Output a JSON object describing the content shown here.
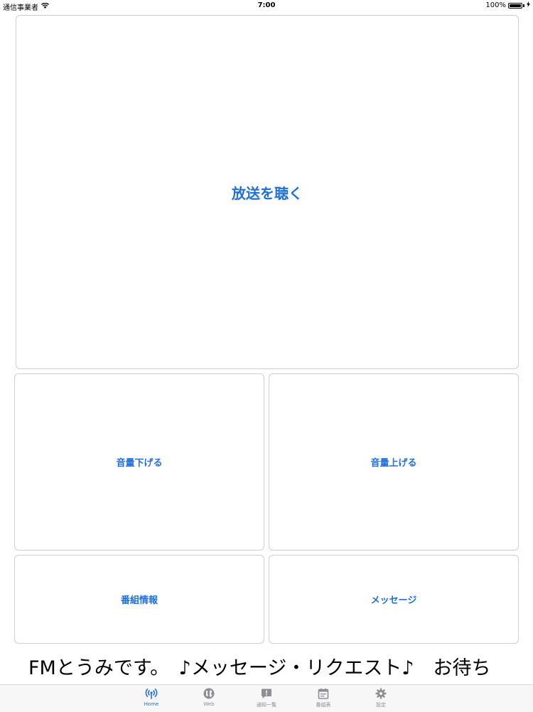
{
  "status_bar": {
    "carrier": "通信事業者",
    "time": "7:00",
    "battery": "100%"
  },
  "buttons": {
    "listen": "放送を聴く",
    "volume_down": "音量下げる",
    "volume_up": "音量上げる",
    "program_info": "番組情報",
    "message": "メッセージ"
  },
  "ticker": {
    "text": "FMとうみです。　♪メッセージ・リクエスト♪　お待ち"
  },
  "tabs": [
    {
      "label": "Home",
      "icon": "radio-antenna-icon",
      "active": true
    },
    {
      "label": "Web",
      "icon": "globe-icon",
      "active": false
    },
    {
      "label": "通知一覧",
      "icon": "notification-icon",
      "active": false
    },
    {
      "label": "番組表",
      "icon": "calendar-icon",
      "active": false
    },
    {
      "label": "設定",
      "icon": "gear-icon",
      "active": false
    }
  ],
  "colors": {
    "accent": "#1f6fdc",
    "inactive_tab": "#8e8e93",
    "card_border": "#cfcfcf"
  }
}
